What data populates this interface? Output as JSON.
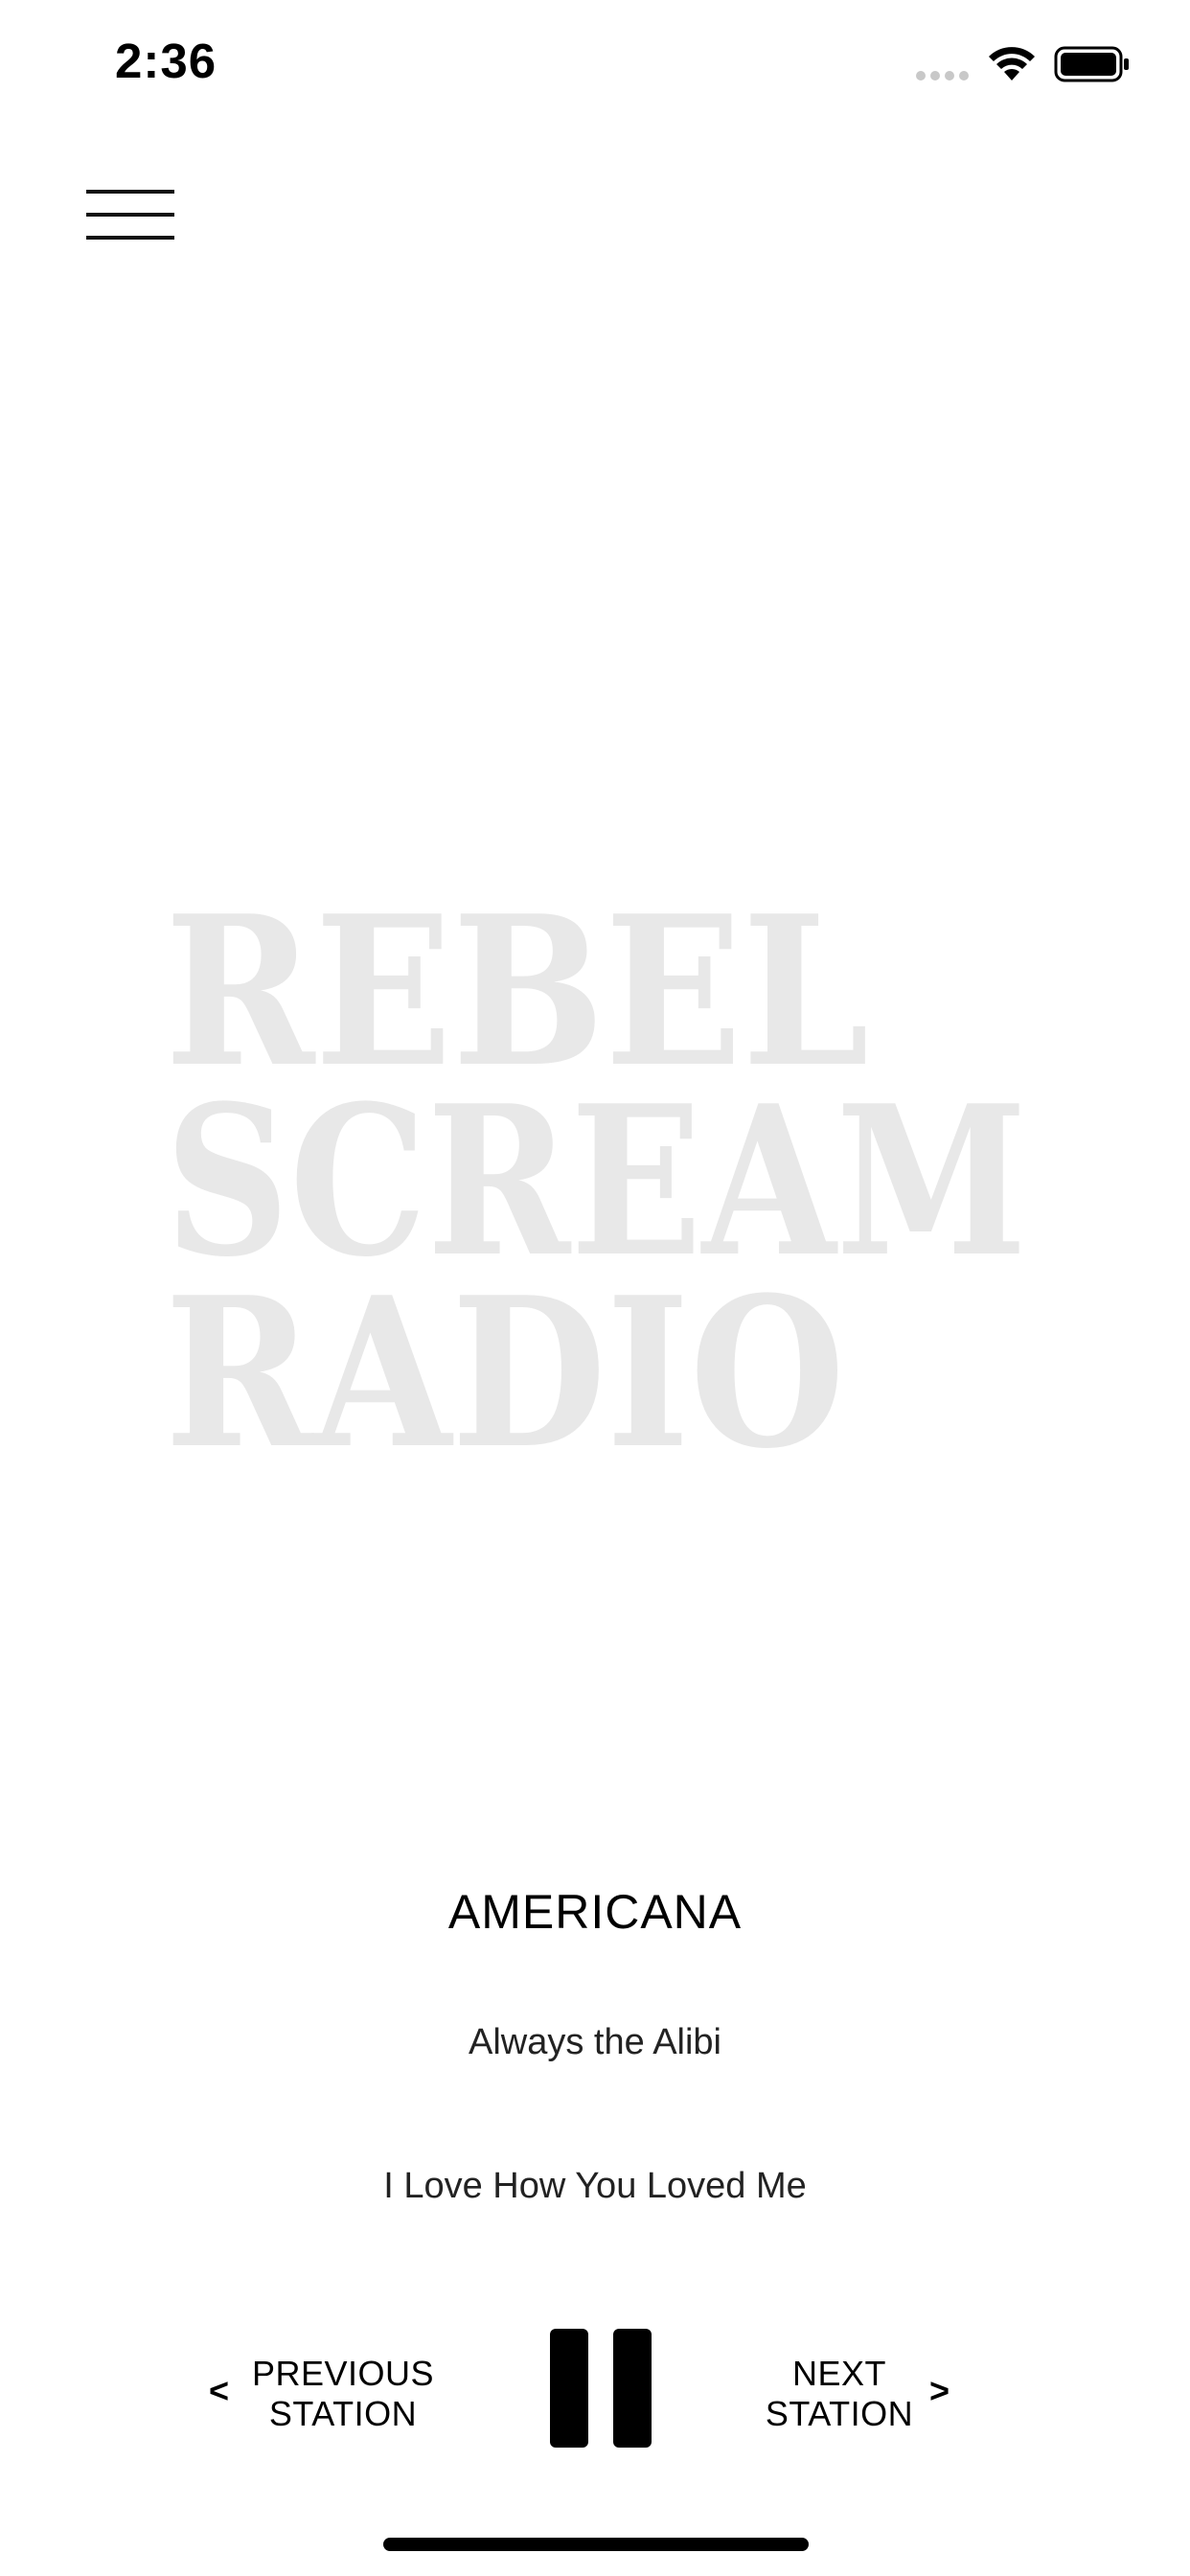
{
  "status_bar": {
    "time": "2:36",
    "icons": [
      "signal-dots-icon",
      "wifi-icon",
      "battery-icon"
    ]
  },
  "header": {
    "menu_icon": "hamburger-menu-icon"
  },
  "logo": {
    "lines": [
      "REBEL",
      "SCREAM",
      "RADIO"
    ],
    "color": "#e8e8e8"
  },
  "now_playing": {
    "station": "AMERICANA",
    "artist": "Always the Alibi",
    "song": "I Love How You Loved Me"
  },
  "controls": {
    "previous_line1": "PREVIOUS",
    "previous_line2": "STATION",
    "previous_chevron": "<",
    "next_line1": "NEXT",
    "next_line2": "STATION",
    "next_chevron": ">",
    "pause_icon": "pause-icon"
  }
}
